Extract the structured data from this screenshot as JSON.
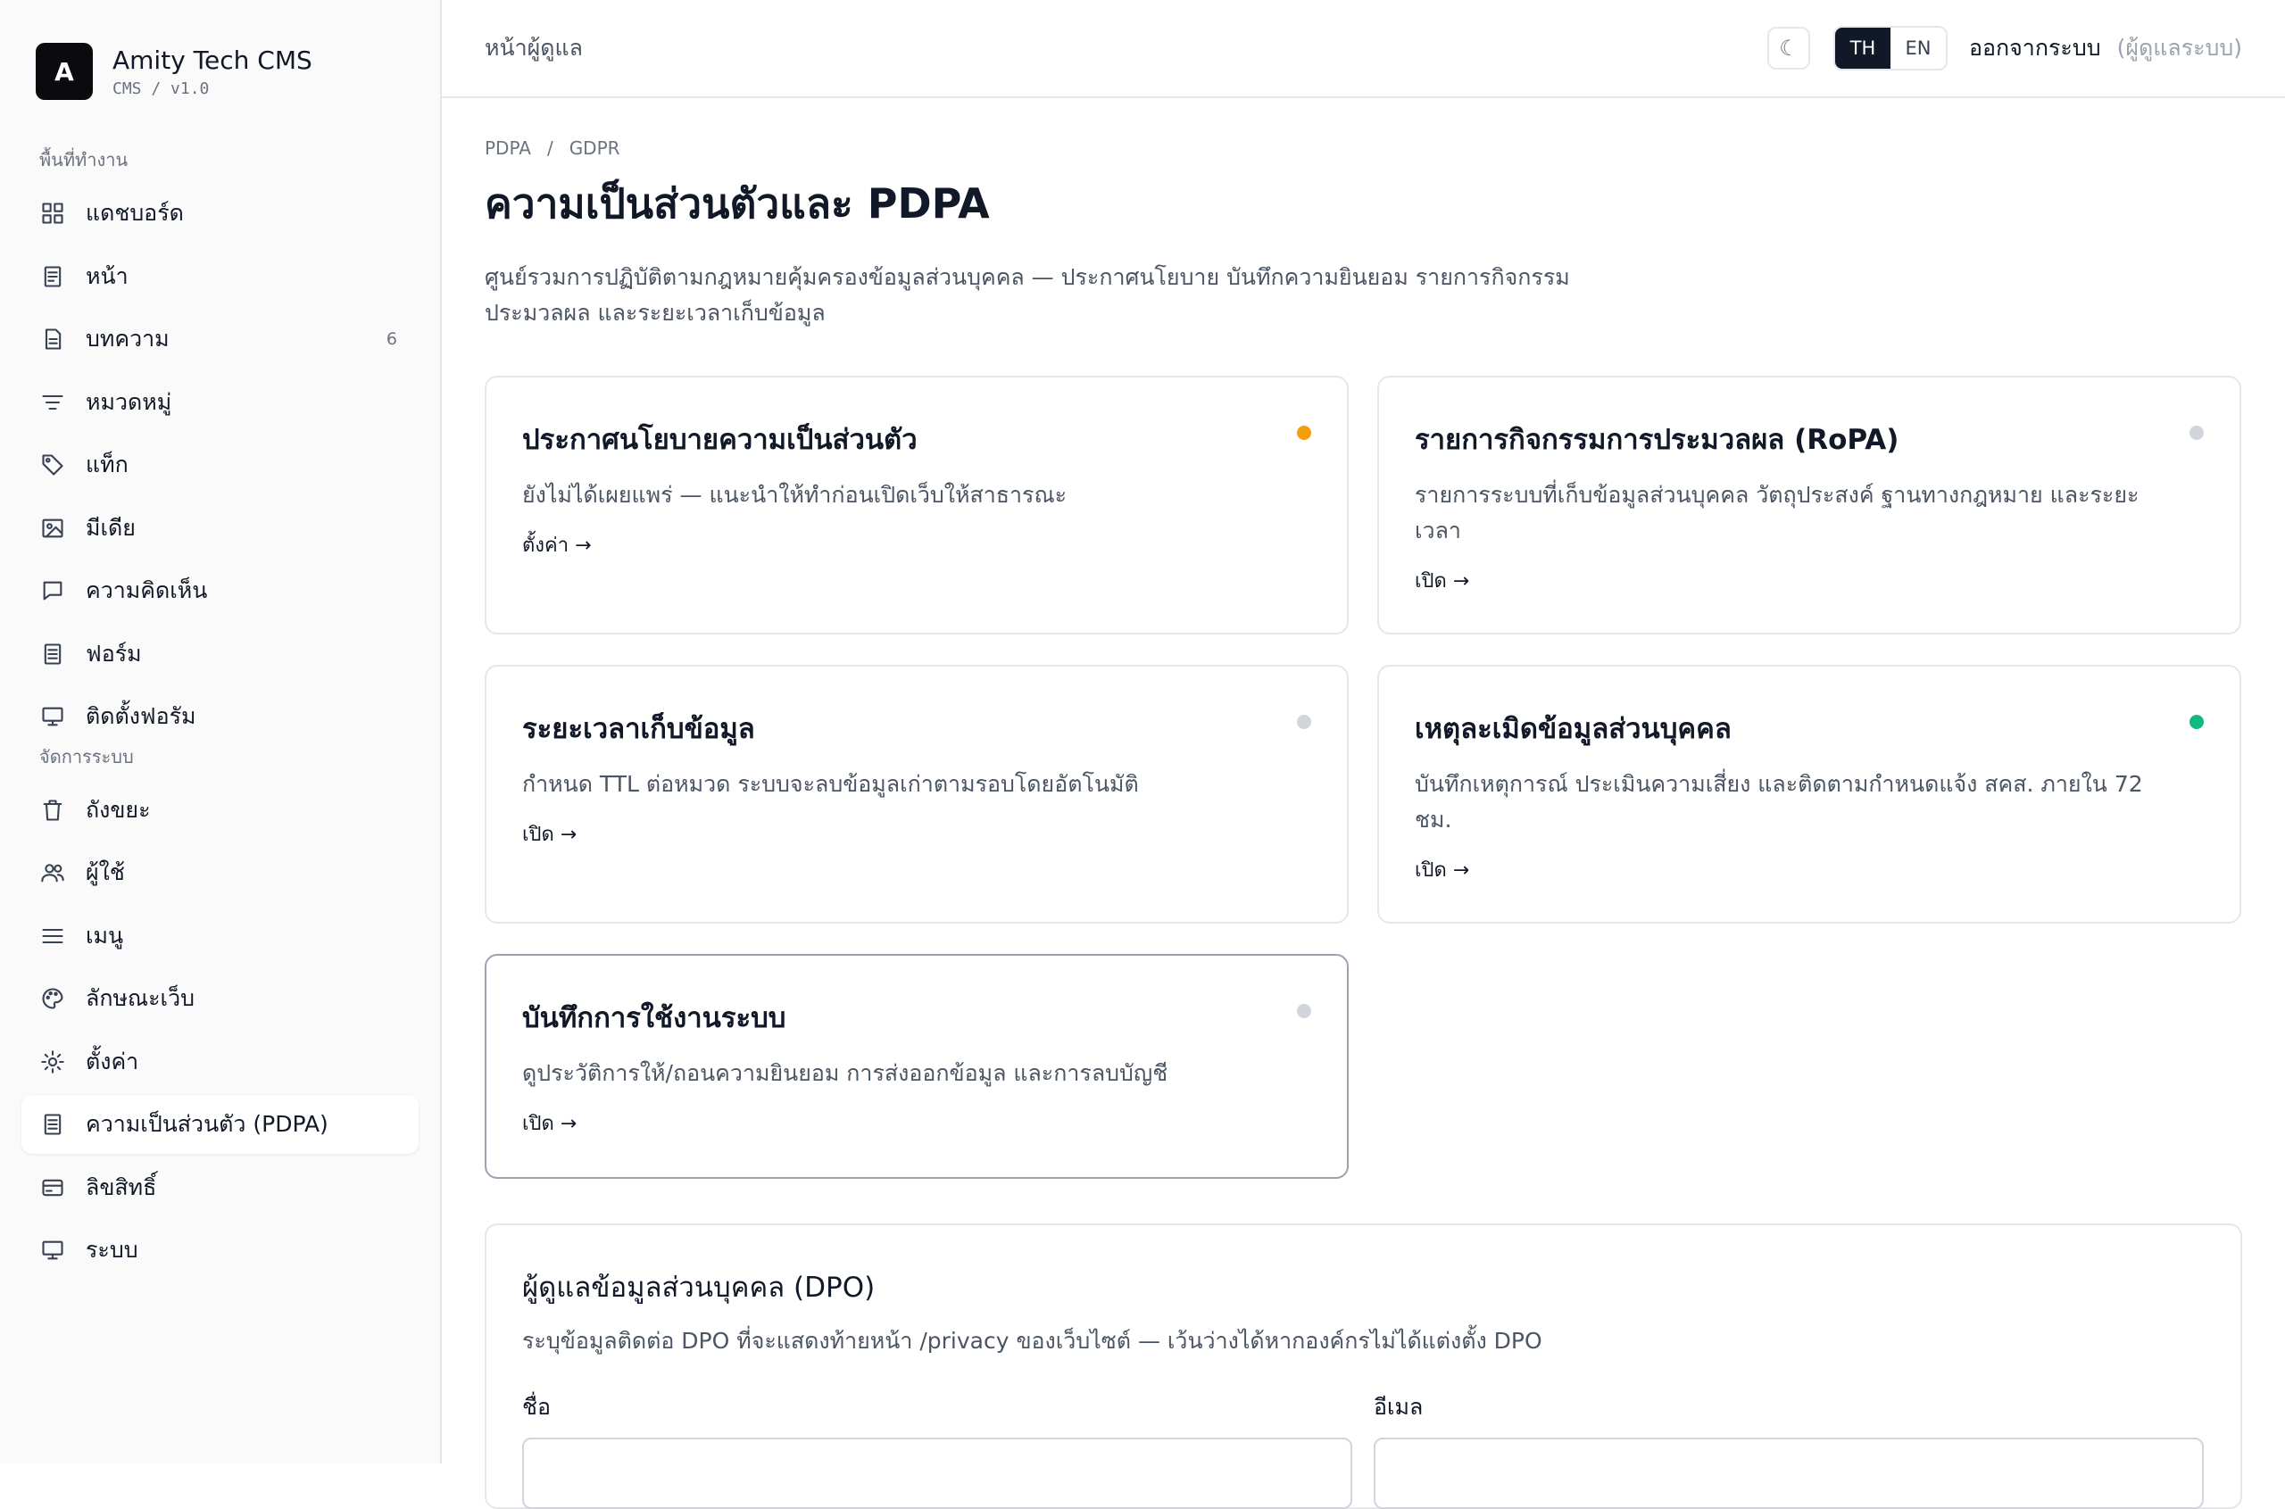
{
  "brand": {
    "logo_letter": "A",
    "name": "Amity Tech CMS",
    "sub": "CMS / v1.0"
  },
  "sidebar": {
    "section_workspace": "พื้นที่ทำงาน",
    "section_system": "จัดการระบบ",
    "workspace_items": [
      {
        "label": "แดชบอร์ด",
        "icon": "dashboard-icon"
      },
      {
        "label": "หน้า",
        "icon": "page-icon"
      },
      {
        "label": "บทความ",
        "icon": "article-icon",
        "badge": "6"
      },
      {
        "label": "หมวดหมู่",
        "icon": "category-icon"
      },
      {
        "label": "แท็ก",
        "icon": "tag-icon"
      },
      {
        "label": "มีเดีย",
        "icon": "media-icon"
      },
      {
        "label": "ความคิดเห็น",
        "icon": "comment-icon"
      },
      {
        "label": "ฟอร์ม",
        "icon": "form-icon"
      },
      {
        "label": "ติดตั้งฟอรัม",
        "icon": "monitor-icon"
      }
    ],
    "system_items": [
      {
        "label": "ถังขยะ",
        "icon": "trash-icon"
      },
      {
        "label": "ผู้ใช้",
        "icon": "users-icon"
      },
      {
        "label": "เมนู",
        "icon": "menu-icon"
      },
      {
        "label": "ลักษณะเว็บ",
        "icon": "palette-icon"
      },
      {
        "label": "ตั้งค่า",
        "icon": "settings-icon"
      },
      {
        "label": "ความเป็นส่วนตัว (PDPA)",
        "icon": "privacy-icon",
        "active": true
      },
      {
        "label": "ลิขสิทธิ์",
        "icon": "license-icon"
      },
      {
        "label": "ระบบ",
        "icon": "system-icon"
      }
    ]
  },
  "topbar": {
    "title": "หน้าผู้ดูแล",
    "theme_icon": "☾",
    "lang_th": "TH",
    "lang_en": "EN",
    "logout": "ออกจากระบบ",
    "role": "(ผู้ดูแลระบบ)"
  },
  "breadcrumb": {
    "first": "PDPA",
    "sep": "/",
    "second": "GDPR"
  },
  "page": {
    "title": "ความเป็นส่วนตัวและ PDPA",
    "description": "ศูนย์รวมการปฏิบัติตามกฎหมายคุ้มครองข้อมูลส่วนบุคคล — ประกาศนโยบาย บันทึกความยินยอม รายการกิจกรรมประมวลผล และระยะเวลาเก็บข้อมูล"
  },
  "cards": [
    {
      "title": "ประกาศนโยบายความเป็นส่วนตัว",
      "desc": "ยังไม่ได้เผยแพร่ — แนะนำให้ทำก่อนเปิดเว็บให้สาธารณะ",
      "link": "ตั้งค่า →",
      "status_color": "#f59e0b"
    },
    {
      "title": "รายการกิจกรรมการประมวลผล (RoPA)",
      "desc": "รายการระบบที่เก็บข้อมูลส่วนบุคคล วัตถุประสงค์ ฐานทางกฎหมาย และระยะเวลา",
      "link": "เปิด →",
      "status_color": "#d1d5db"
    },
    {
      "title": "ระยะเวลาเก็บข้อมูล",
      "desc": "กำหนด TTL ต่อหมวด ระบบจะลบข้อมูลเก่าตามรอบโดยอัตโนมัติ",
      "link": "เปิด →",
      "status_color": "#d1d5db"
    },
    {
      "title": "เหตุละเมิดข้อมูลส่วนบุคคล",
      "desc": "บันทึกเหตุการณ์ ประเมินความเสี่ยง และติดตามกำหนดแจ้ง สคส. ภายใน 72 ชม.",
      "link": "เปิด →",
      "status_color": "#10b981"
    },
    {
      "title": "บันทึกการใช้งานระบบ",
      "desc": "ดูประวัติการให้/ถอนความยินยอม การส่งออกข้อมูล และการลบบัญชี",
      "link": "เปิด →",
      "status_color": "#d1d5db"
    }
  ],
  "dpo": {
    "title": "ผู้ดูแลข้อมูลส่วนบุคคล (DPO)",
    "description": "ระบุข้อมูลติดต่อ DPO ที่จะแสดงท้ายหน้า /privacy ของเว็บไซต์ — เว้นว่างได้หากองค์กรไม่ได้แต่งตั้ง DPO",
    "name_label": "ชื่อ",
    "name_value": "",
    "email_label": "อีเมล",
    "email_value": ""
  }
}
